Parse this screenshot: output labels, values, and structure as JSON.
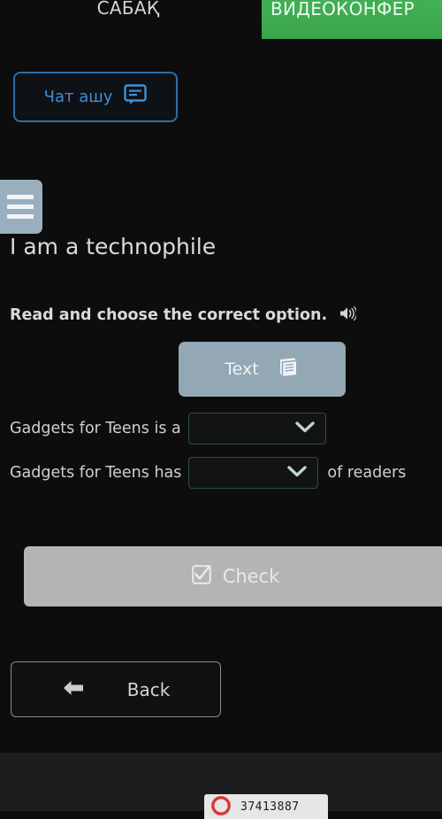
{
  "tabs": {
    "lesson_label": "САБАҚ",
    "videoconf_label": "ВИДЕОКОНФЕР",
    "active_color": "#41ad52"
  },
  "chat": {
    "label": "Чат ашу",
    "icon": "chat-icon",
    "accent_color": "#3f8fd8"
  },
  "menu": {
    "icon": "hamburger-icon"
  },
  "lesson": {
    "title": "I am a technophile"
  },
  "instruction": {
    "text": "Read and choose the correct option.",
    "audio_icon": "speaker-icon"
  },
  "text_button": {
    "label": "Text",
    "icon": "book-icon",
    "background": "#93a7b4"
  },
  "exercise": {
    "rows": [
      {
        "lead_text": "Gadgets for Teens is a",
        "trail_text": "",
        "select_value": "",
        "chevron_icon": "chevron-down-icon"
      },
      {
        "lead_text": "Gadgets for Teens has",
        "trail_text": "of readers",
        "select_value": "",
        "chevron_icon": "chevron-down-icon"
      }
    ]
  },
  "check_button": {
    "label": "Check",
    "icon": "checkbox-checked-icon",
    "background": "#b4b4b4"
  },
  "back_button": {
    "label": "Back",
    "icon": "arrow-left-icon"
  },
  "bottom_badge": {
    "number": "37413887",
    "icon": "red-circle-icon",
    "icon_color": "#d63a33"
  }
}
